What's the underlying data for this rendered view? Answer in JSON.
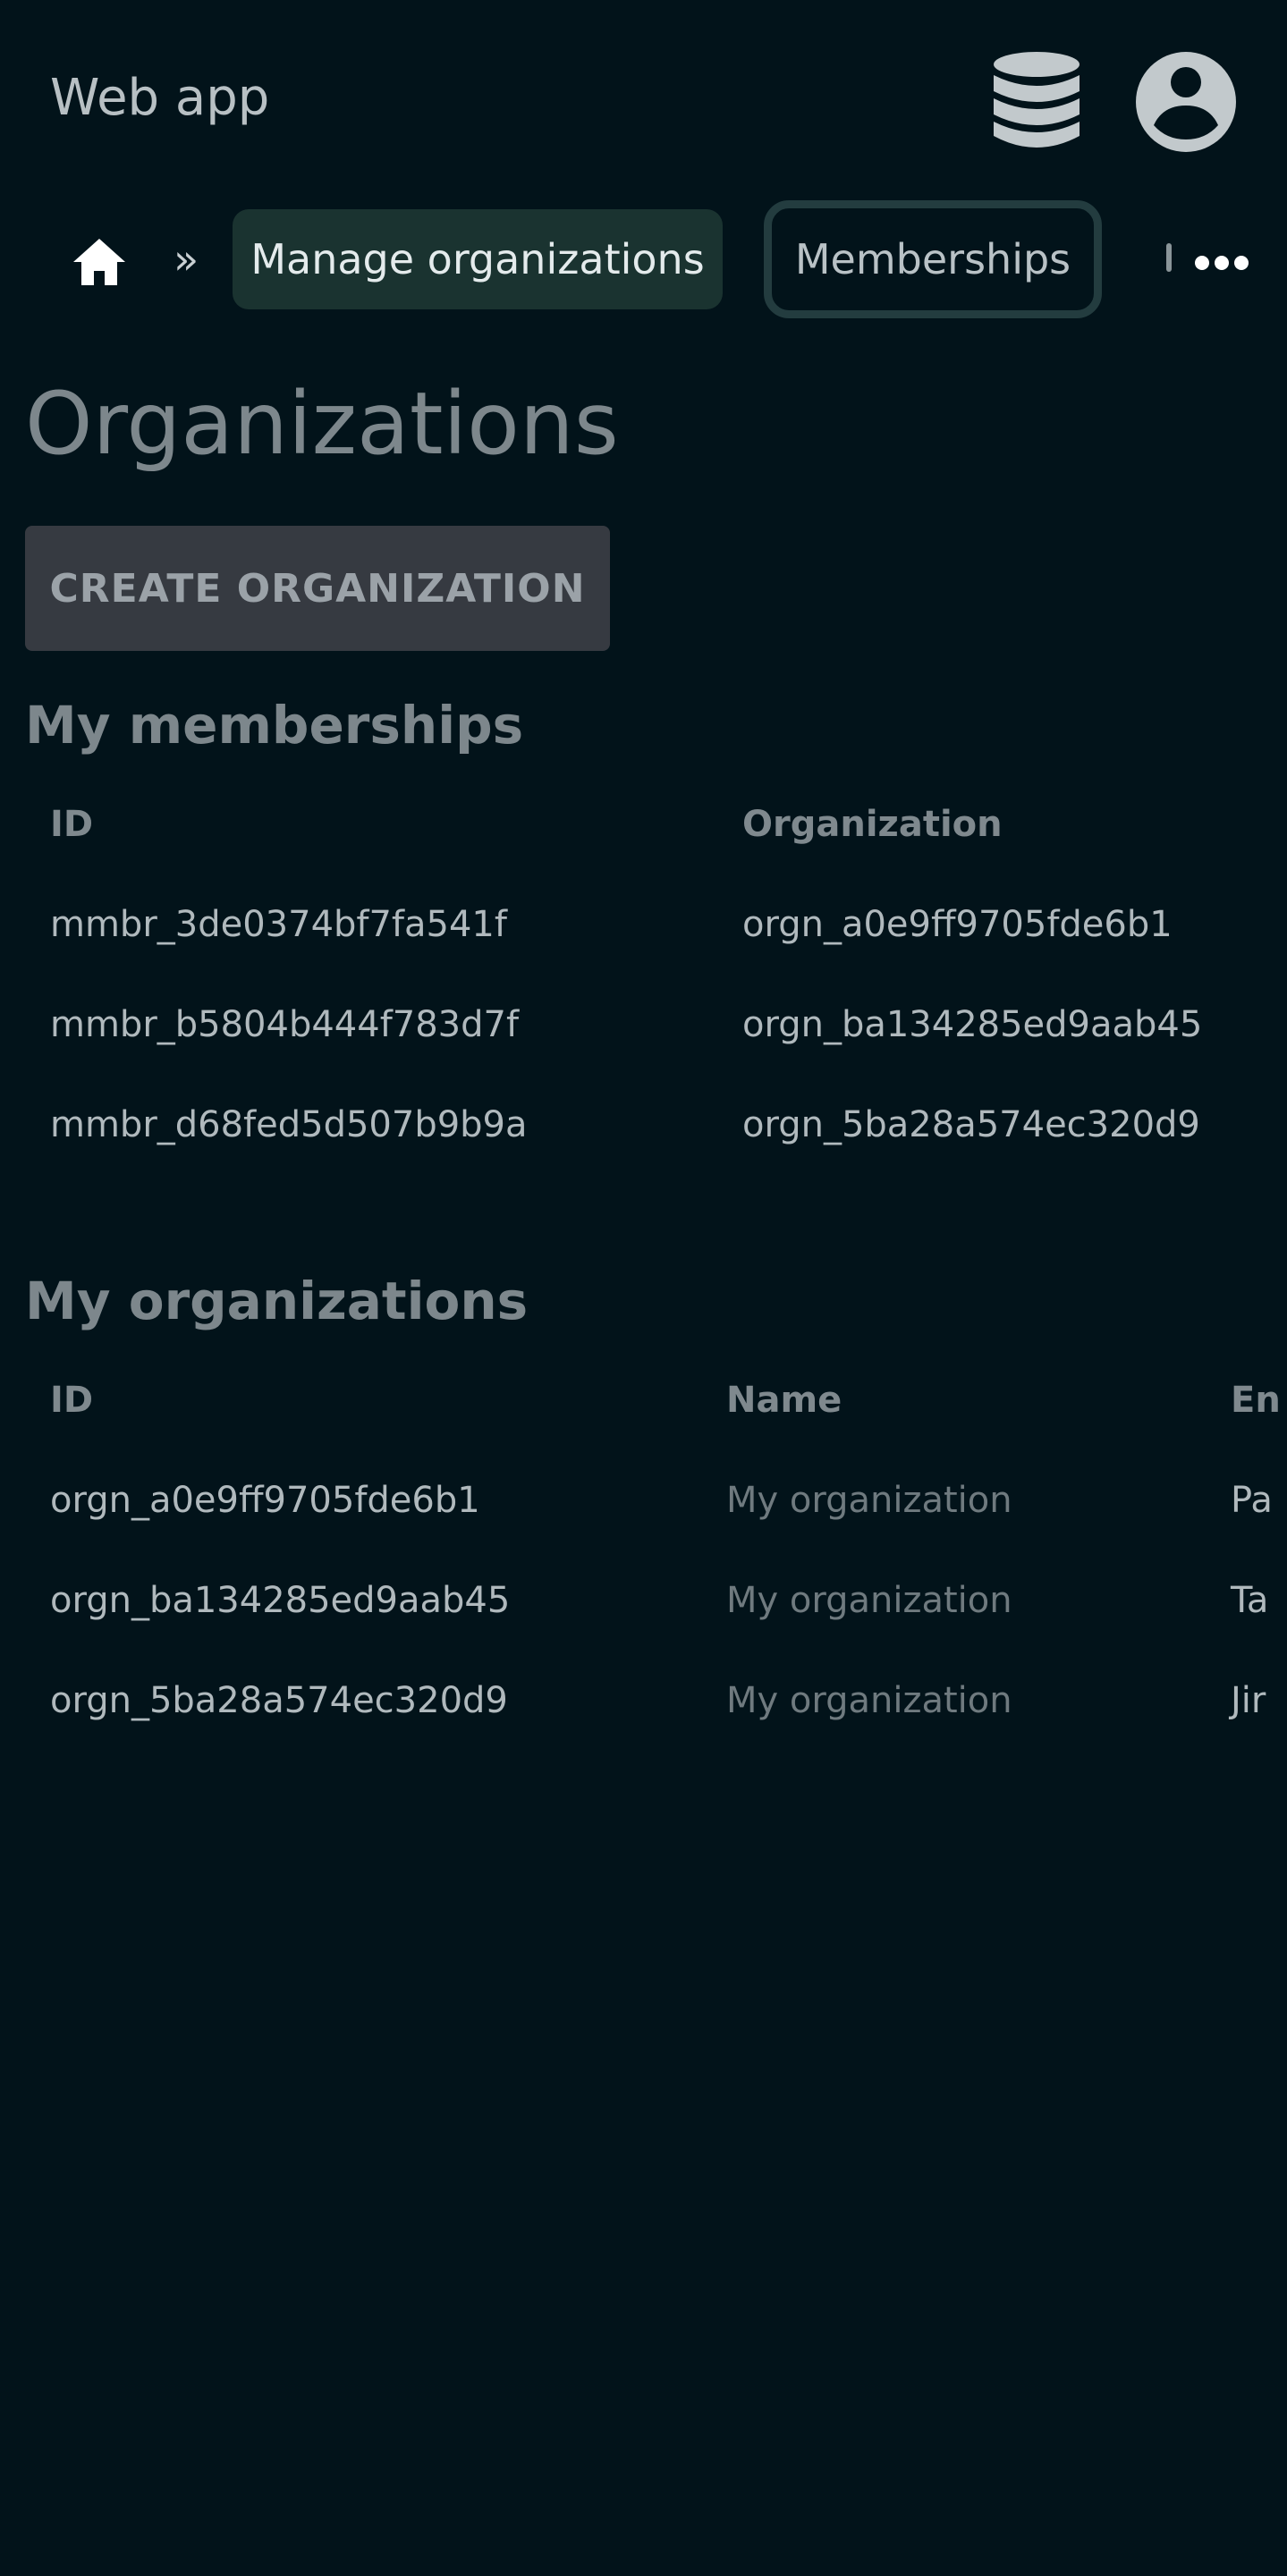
{
  "header": {
    "app_title": "Web app",
    "database_icon": "database-icon",
    "account_icon": "account-circle-icon"
  },
  "breadcrumb": {
    "home_icon": "home-icon",
    "separator": "»",
    "items": [
      {
        "label": "Manage organizations",
        "active": true
      },
      {
        "label": "Memberships",
        "active": false
      }
    ],
    "more_icon": "more-horizontal-icon"
  },
  "page": {
    "title": "Organizations",
    "create_button": "CREATE ORGANIZATION"
  },
  "memberships": {
    "title": "My memberships",
    "columns": [
      "ID",
      "Organization"
    ],
    "rows": [
      [
        "mmbr_3de0374bf7fa541f",
        "orgn_a0e9ff9705fde6b1"
      ],
      [
        "mmbr_b5804b444f783d7f",
        "orgn_ba134285ed9aab45"
      ],
      [
        "mmbr_d68fed5d507b9b9a",
        "orgn_5ba28a574ec320d9"
      ]
    ]
  },
  "organizations": {
    "title": "My organizations",
    "columns": [
      "ID",
      "Name",
      "En"
    ],
    "rows": [
      [
        "orgn_a0e9ff9705fde6b1",
        "My organization",
        "Pa"
      ],
      [
        "orgn_ba134285ed9aab45",
        "My organization",
        "Ta"
      ],
      [
        "orgn_5ba28a574ec320d9",
        "My organization",
        "Jir"
      ]
    ]
  },
  "colors": {
    "background": "#02131a",
    "active_crumb": "#1a3330",
    "outline_crumb": "#233c3f",
    "button": "#363a41"
  }
}
